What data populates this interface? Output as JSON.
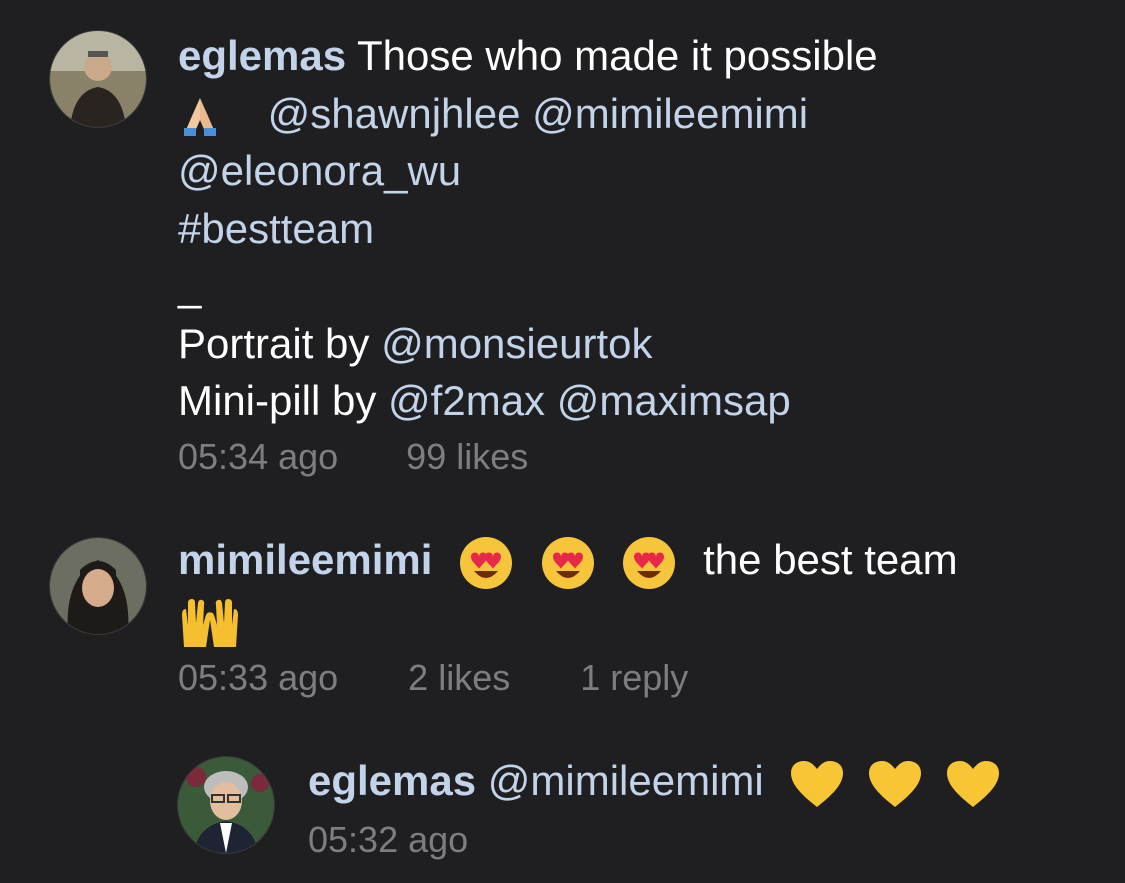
{
  "comments": [
    {
      "username": "eglemas",
      "text_line1": "Those who made it possible",
      "mention1": "@shawnjhlee",
      "mention2": "@mimileemimi",
      "mention3": "@eleonora_wu",
      "hashtag": "#bestteam",
      "separator": "_",
      "portrait_label": "Portrait by",
      "portrait_mention": "@monsieurtok",
      "minipill_label": "Mini-pill by",
      "minipill_mention1": "@f2max",
      "minipill_mention2": "@maximsap",
      "time": "05:34 ago",
      "likes": "99 likes",
      "emoji": "folded-hands"
    },
    {
      "username": "mimileemimi",
      "text": "the best team",
      "emoji_row": [
        "heart-eyes",
        "heart-eyes",
        "heart-eyes"
      ],
      "emoji_line2": "raising-hands",
      "time": "05:33 ago",
      "likes": "2 likes",
      "reply_link": "1 reply"
    },
    {
      "username": "eglemas",
      "mention": "@mimileemimi",
      "emoji_row": [
        "yellow-heart",
        "yellow-heart",
        "yellow-heart"
      ],
      "time": "05:32 ago"
    }
  ],
  "colors": {
    "background": "#1f1f21",
    "username": "#c3d3ea",
    "mention": "#c3d3ea",
    "text": "#ffffff",
    "meta": "#7e7e82"
  }
}
